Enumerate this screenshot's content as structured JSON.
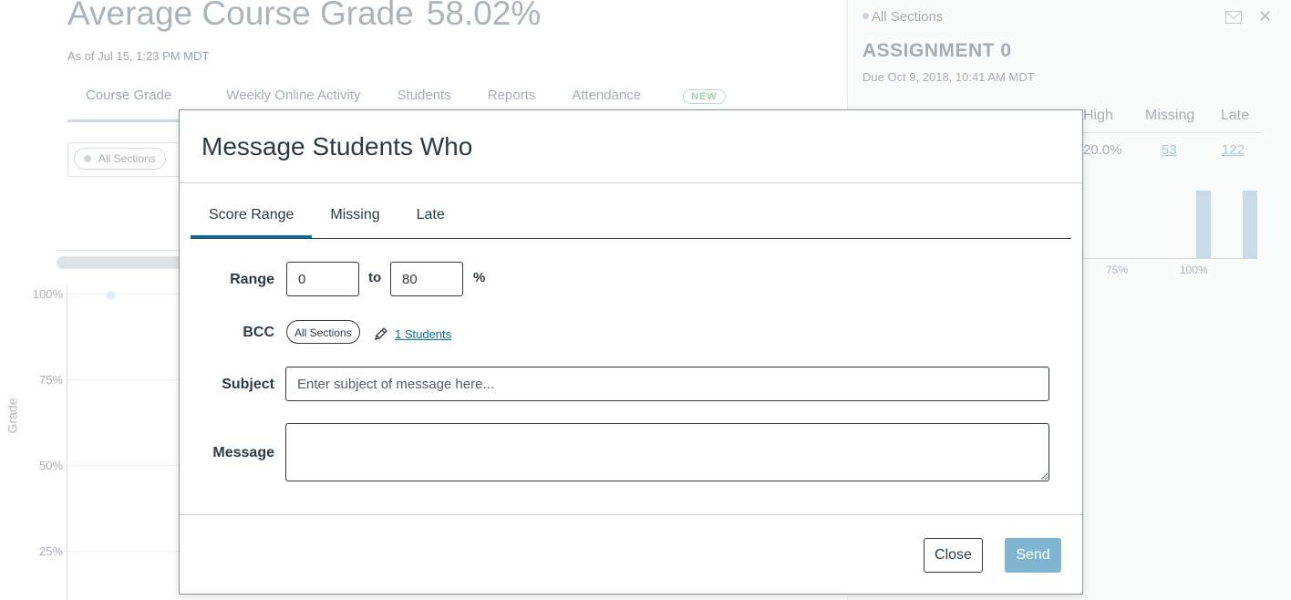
{
  "background": {
    "title": "Average Course Grade",
    "title_value": "58.02%",
    "as_of": "As of Jul 15, 1:23 PM MDT",
    "tabs": [
      "Course Grade",
      "Weekly Online Activity",
      "Students",
      "Reports",
      "Attendance"
    ],
    "new_badge": "NEW",
    "filter_pill": "All Sections",
    "y_axis_label": "Grade",
    "y_ticks": [
      "100%",
      "75%",
      "50%",
      "25%"
    ]
  },
  "side_panel": {
    "section": "All Sections",
    "assignment": "ASSIGNMENT 0",
    "due": "Due Oct 9, 2018, 10:41 AM MDT",
    "headers": {
      "high": "High",
      "missing": "Missing",
      "late": "Late"
    },
    "values": {
      "high": "20.0%",
      "missing": "53",
      "late": "122"
    },
    "axis_ticks": [
      "75%",
      "100%"
    ],
    "icons": [
      "envelope-icon",
      "close-icon"
    ]
  },
  "modal": {
    "title": "Message Students Who",
    "tabs": [
      "Score Range",
      "Missing",
      "Late"
    ],
    "active_tab": "Score Range",
    "range": {
      "label": "Range",
      "from": "0",
      "to_label": "to",
      "to": "80",
      "unit": "%"
    },
    "bcc": {
      "label": "BCC",
      "pill": "All Sections",
      "students_link": "1 Students",
      "icon": "pencil-icon"
    },
    "subject": {
      "label": "Subject",
      "placeholder": "Enter subject of message here...",
      "value": ""
    },
    "message": {
      "label": "Message",
      "value": ""
    },
    "buttons": {
      "close": "Close",
      "send": "Send"
    },
    "colors": {
      "accent": "#0770a3",
      "send_disabled": "#7fb5d1",
      "text": "#2d3b45"
    }
  }
}
